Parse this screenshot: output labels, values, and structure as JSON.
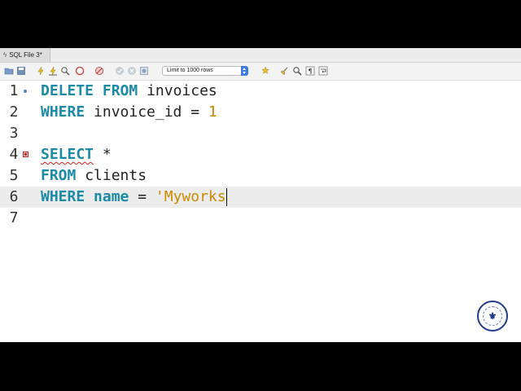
{
  "tab": {
    "title": "SQL File 3*"
  },
  "toolbar": {
    "limit_select": "Limit to 1000 rows",
    "icons": [
      "open-folder-icon",
      "save-icon",
      "execute-icon",
      "execute-current-icon",
      "explain-icon",
      "stop-icon",
      "toggle-error-icon",
      "commit-icon",
      "rollback-icon",
      "autocommit-icon",
      "beautify-icon",
      "broom-icon",
      "find-icon",
      "invisible-chars-icon",
      "wrap-icon"
    ]
  },
  "editor": {
    "lines": [
      {
        "num": "1",
        "tokens": [
          {
            "t": "DELETE",
            "c": "kw"
          },
          {
            "t": " "
          },
          {
            "t": "FROM",
            "c": "kw"
          },
          {
            "t": " invoices"
          }
        ]
      },
      {
        "num": "2",
        "tokens": [
          {
            "t": "WHERE",
            "c": "kw"
          },
          {
            "t": " invoice_id = "
          },
          {
            "t": "1",
            "c": "num"
          }
        ]
      },
      {
        "num": "3",
        "tokens": []
      },
      {
        "num": "4",
        "tokens": [
          {
            "t": "SELECT",
            "c": "kw squig"
          },
          {
            "t": " *"
          }
        ]
      },
      {
        "num": "5",
        "tokens": [
          {
            "t": "FROM",
            "c": "kw"
          },
          {
            "t": " clients"
          }
        ]
      },
      {
        "num": "6",
        "tokens": [
          {
            "t": "WHERE",
            "c": "kw"
          },
          {
            "t": " "
          },
          {
            "t": "name",
            "c": "kw"
          },
          {
            "t": " = "
          },
          {
            "t": "'Myworks",
            "c": "str"
          }
        ]
      },
      {
        "num": "7",
        "tokens": []
      }
    ]
  },
  "colors": {
    "keyword": "#1a8aa5",
    "literal": "#c88a00",
    "current_line": "#ececec",
    "limit_arrow": "#3b7be0"
  }
}
